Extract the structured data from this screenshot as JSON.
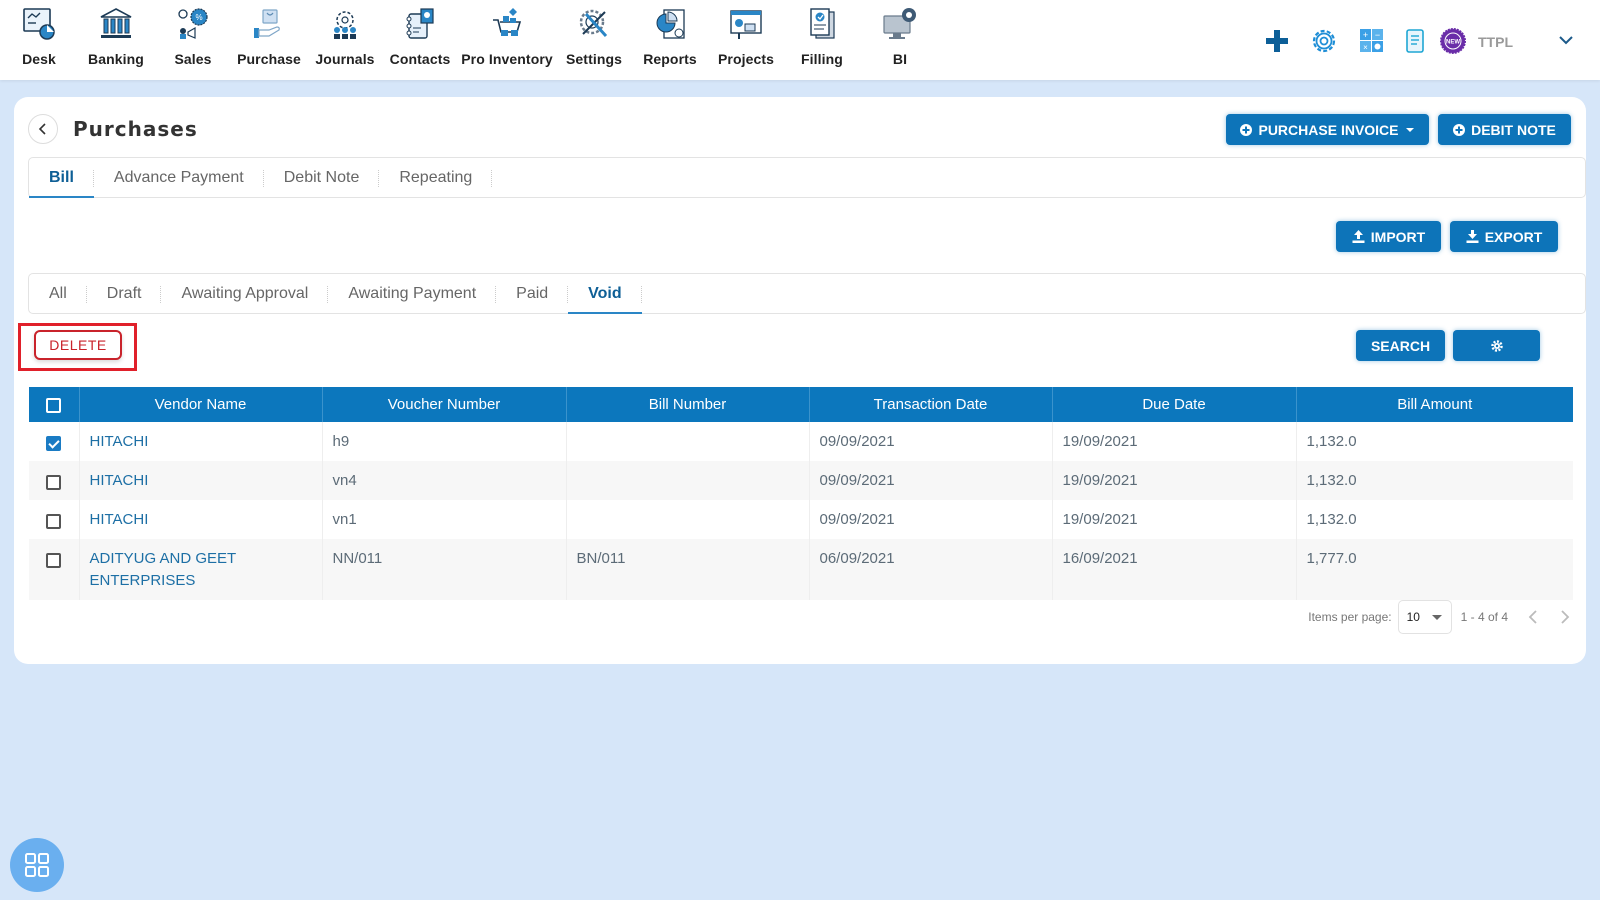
{
  "nav": {
    "items": [
      {
        "label": "Desk",
        "icon": "desk-dashboard-icon"
      },
      {
        "label": "Banking",
        "icon": "bank-icon"
      },
      {
        "label": "Sales",
        "icon": "sales-icon"
      },
      {
        "label": "Purchase",
        "icon": "purchase-bag-hand-icon"
      },
      {
        "label": "Journals",
        "icon": "journals-team-icon"
      },
      {
        "label": "Contacts",
        "icon": "contacts-book-icon"
      },
      {
        "label": "Pro Inventory",
        "icon": "inventory-cart-icon"
      },
      {
        "label": "Settings",
        "icon": "settings-tools-icon"
      },
      {
        "label": "Reports",
        "icon": "reports-chart-icon"
      },
      {
        "label": "Projects",
        "icon": "projects-board-icon"
      },
      {
        "label": "Filling",
        "icon": "filling-document-icon"
      },
      {
        "label": "BI",
        "icon": "bi-monitor-gear-icon"
      }
    ],
    "right": {
      "company": "TTPL",
      "icons": [
        "plus-icon",
        "gear-icon",
        "calculator-icon",
        "notes-icon",
        "new-badge-icon",
        "chevron-down-icon"
      ],
      "new_badge_text": "NEW"
    }
  },
  "page": {
    "title": "Purchases",
    "buttons": {
      "purchase_invoice": "PURCHASE INVOICE",
      "debit_note": "DEBIT NOTE",
      "import": "IMPORT",
      "export": "EXPORT",
      "search": "SEARCH",
      "delete": "DELETE"
    },
    "main_tabs": [
      {
        "label": "Bill",
        "active": true
      },
      {
        "label": "Advance Payment",
        "active": false
      },
      {
        "label": "Debit Note",
        "active": false
      },
      {
        "label": "Repeating",
        "active": false
      }
    ],
    "status_tabs": [
      {
        "label": "All",
        "active": false
      },
      {
        "label": "Draft",
        "active": false
      },
      {
        "label": "Awaiting Approval",
        "active": false
      },
      {
        "label": "Awaiting Payment",
        "active": false
      },
      {
        "label": "Paid",
        "active": false
      },
      {
        "label": "Void",
        "active": true
      }
    ]
  },
  "table": {
    "columns": [
      "Vendor Name",
      "Voucher Number",
      "Bill Number",
      "Transaction Date",
      "Due Date",
      "Bill Amount"
    ],
    "rows": [
      {
        "checked": true,
        "vendor": "HITACHI",
        "voucher": "h9",
        "bill": "",
        "txn_date": "09/09/2021",
        "due_date": "19/09/2021",
        "amount": "1,132.0"
      },
      {
        "checked": false,
        "vendor": "HITACHI",
        "voucher": "vn4",
        "bill": "",
        "txn_date": "09/09/2021",
        "due_date": "19/09/2021",
        "amount": "1,132.0"
      },
      {
        "checked": false,
        "vendor": "HITACHI",
        "voucher": "vn1",
        "bill": "",
        "txn_date": "09/09/2021",
        "due_date": "19/09/2021",
        "amount": "1,132.0"
      },
      {
        "checked": false,
        "vendor": "ADITYUG AND GEET ENTERPRISES",
        "voucher": "NN/011",
        "bill": "BN/011",
        "txn_date": "06/09/2021",
        "due_date": "16/09/2021",
        "amount": "1,777.0"
      }
    ]
  },
  "paginator": {
    "items_per_page_label": "Items per page:",
    "items_per_page": "10",
    "range": "1 - 4 of 4"
  },
  "colors": {
    "primary": "#0d74b9",
    "danger": "#c9232b",
    "background": "#d6e6f9"
  }
}
